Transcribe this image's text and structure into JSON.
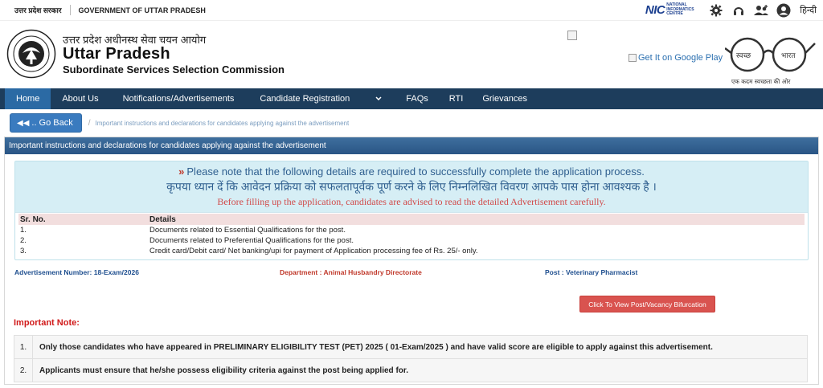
{
  "topbar": {
    "hindi_gov": "उत्तर प्रदेश सरकार",
    "english_gov": "GOVERNMENT OF UTTAR PRADESH",
    "nic_mark": "NIC",
    "nic_text": "NATIONAL INFORMATICS CENTRE",
    "language_link": "हिन्दी",
    "icons": [
      "gear-icon",
      "headset-icon",
      "users-icon",
      "user-icon"
    ]
  },
  "header": {
    "org_hindi": "उत्तर प्रदेश अधीनस्थ सेवा चयन आयोग",
    "org_title": "Uttar Pradesh",
    "org_subtitle": "Subordinate Services Selection Commission",
    "play_store_link": "Get It on Google Play",
    "swachh_left": "स्वच्छ",
    "swachh_right": "भारत",
    "swachh_tagline": "एक कदम स्वच्छता की ओर"
  },
  "nav": {
    "items": [
      "Home",
      "About Us",
      "Notifications/Advertisements",
      "Candidate Registration",
      "FAQs",
      "RTI",
      "Grievances"
    ],
    "active_index": 0
  },
  "breadcrumb": {
    "back_label": ".. Go Back",
    "current": "Important instructions and declarations for candidates applying against the advertisement"
  },
  "panel": {
    "title": "Important instructions and declarations for candidates applying against the advertisement",
    "notice_en": "Please note that the following details are required to successfully complete the application process.",
    "notice_hi": "कृपया ध्यान दें कि आवेदन प्रक्रिया को सफलतापूर्वक पूर्ण करने के लिए निम्नलिखित विवरण आपके पास होना आवश्यक है ।",
    "notice_warn": "Before filling up the application, candidates are advised to read the detailed Advertisement carefully.",
    "table_headers": [
      "Sr. No.",
      "Details"
    ],
    "requirements": [
      {
        "no": "1.",
        "detail": "Documents related to Essential Qualifications for the post."
      },
      {
        "no": "2.",
        "detail": "Documents related to Preferential Qualifications for the post."
      },
      {
        "no": "3.",
        "detail": "Credit card/Debit card/ Net banking/upi for payment of Application processing fee of Rs. 25/- only."
      }
    ],
    "advertisement_number": "Advertisement Number: 18-Exam/2026",
    "department": "Department : Animal Husbandry Directorate",
    "post": "Post : Veterinary Pharmacist",
    "vacancy_button": "Click To View Post/Vacancy Bifurcation",
    "important_note_label": "Important Note:",
    "notes": [
      {
        "no": "1.",
        "text": "Only those candidates who have appeared in PRELIMINARY ELIGIBILITY TEST (PET) 2025 ( 01-Exam/2025 ) and have valid score are eligible to apply against this advertisement."
      },
      {
        "no": "2.",
        "text": "Applicants must ensure that he/she possess eligibility criteria against the post being applied for."
      }
    ]
  },
  "colors": {
    "nav_bg": "#1d3d5c",
    "nav_active": "#2b6aa4",
    "panel_head": "#2a5585",
    "notice_bg": "#d6eef5",
    "danger": "#d9534f",
    "primary": "#3a7bbf"
  }
}
